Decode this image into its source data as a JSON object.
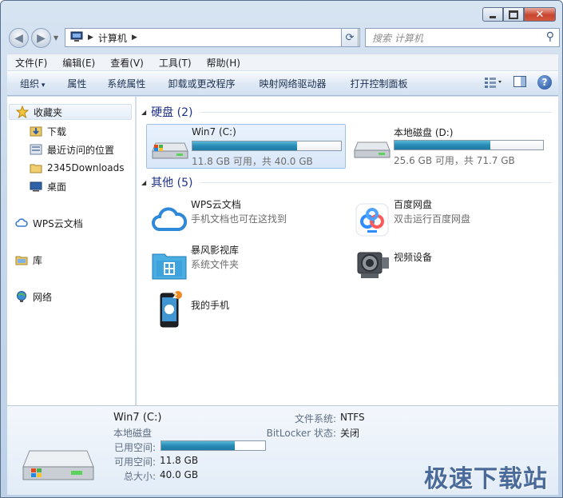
{
  "window": {
    "close_glyph": "✕"
  },
  "nav": {
    "breadcrumb": "计算机",
    "search_placeholder": "搜索 计算机"
  },
  "menu": [
    "文件(F)",
    "编辑(E)",
    "查看(V)",
    "工具(T)",
    "帮助(H)"
  ],
  "commands": {
    "organize": "组织",
    "properties": "属性",
    "system_properties": "系统属性",
    "uninstall": "卸载或更改程序",
    "map_drive": "映射网络驱动器",
    "control_panel": "打开控制面板"
  },
  "sidebar": {
    "favorites": "收藏夹",
    "downloads": "下载",
    "recent": "最近访问的位置",
    "folder2345": "2345Downloads",
    "desktop": "桌面",
    "wps": "WPS云文档",
    "library": "库",
    "network": "网络"
  },
  "groups": {
    "drives": "硬盘 (2)",
    "other": "其他 (5)"
  },
  "drives": [
    {
      "name": "Win7 (C:)",
      "free": "11.8 GB 可用，共 40.0 GB",
      "used_fraction": 0.705
    },
    {
      "name": "本地磁盘 (D:)",
      "free": "25.6 GB 可用，共 71.7 GB",
      "used_fraction": 0.643
    }
  ],
  "others": [
    {
      "name": "WPS云文档",
      "sub": "手机文档也可在这找到"
    },
    {
      "name": "百度网盘",
      "sub": "双击运行百度网盘"
    },
    {
      "name": "暴风影视库",
      "sub": "系统文件夹"
    },
    {
      "name": "视频设备",
      "sub": ""
    },
    {
      "name": "我的手机",
      "sub": "",
      "badge": "2"
    }
  ],
  "details": {
    "title": "Win7 (C:)",
    "type": "本地磁盘",
    "used_label": "已用空间:",
    "used_fraction": 0.705,
    "free_label": "可用空间:",
    "free_value": "11.8 GB",
    "total_label": "总大小:",
    "total_value": "40.0 GB",
    "fs_label": "文件系统:",
    "fs_value": "NTFS",
    "bitlocker_label": "BitLocker 状态:",
    "bitlocker_value": "关闭"
  },
  "watermark": "极速下载站",
  "colors": {
    "accent": "#1e3287",
    "bar": "#2a8bb5"
  }
}
